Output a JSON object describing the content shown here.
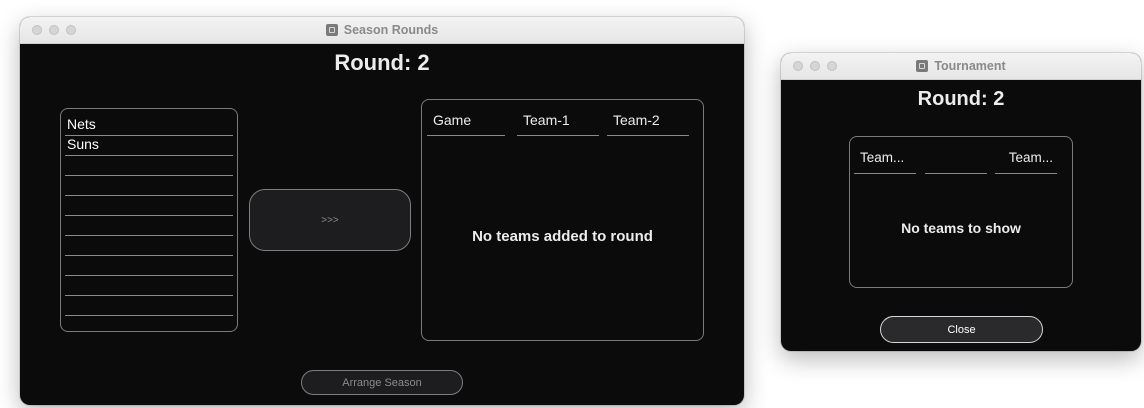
{
  "season_window": {
    "title": "Season Rounds",
    "round_label": "Round: 2",
    "teams": [
      "Nets",
      "Suns",
      "",
      "",
      "",
      "",
      "",
      "",
      "",
      ""
    ],
    "move_button": ">>>",
    "table_headers": [
      "Game",
      "Team-1",
      "Team-2"
    ],
    "empty_message": "No teams added to round",
    "arrange_button": "Arrange Season"
  },
  "tournament_window": {
    "title": "Tournament",
    "round_label": "Round: 2",
    "table_headers": [
      "Team...",
      "",
      "Team..."
    ],
    "empty_message": "No teams to show",
    "close_button": "Close"
  }
}
